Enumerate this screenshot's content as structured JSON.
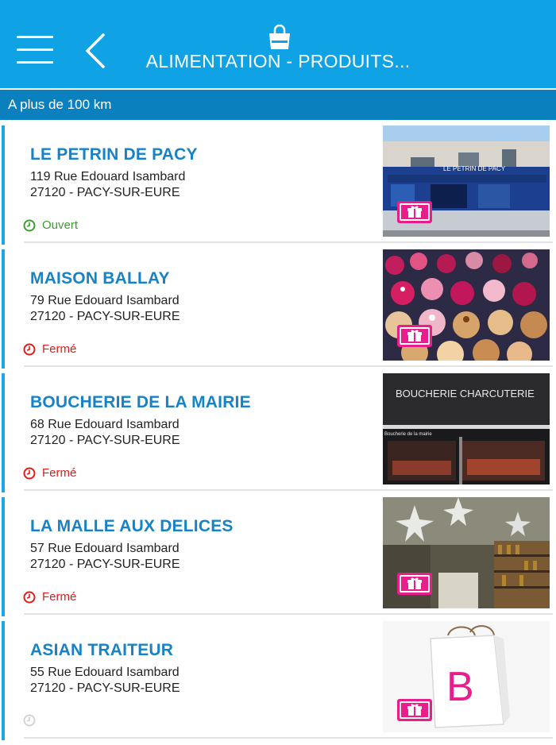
{
  "header": {
    "title": "ALIMENTATION - PRODUITS...",
    "menu_icon": "hamburger-menu-icon",
    "back_icon": "chevron-left-icon",
    "category_icon": "shopping-bag-icon",
    "bg_color": "#0fa3e6"
  },
  "subbar": {
    "label": "A plus de 100 km",
    "bg_color": "#0b80bf"
  },
  "colors": {
    "accent": "#1aa6e8",
    "name": "#1683c9",
    "open": "#3a9d2f",
    "closed": "#e11a1a",
    "gift": "#e91e8c"
  },
  "shops": [
    {
      "name": "LE PETRIN DE PACY",
      "address": "119 Rue Edouard Isambard",
      "city": "27120 - PACY-SUR-EURE",
      "status": "Ouvert",
      "status_type": "open",
      "image": "bakery-storefront"
    },
    {
      "name": "MAISON BALLAY",
      "address": "79 Rue Edouard Isambard",
      "city": "27120 - PACY-SUR-EURE",
      "status": "Fermé",
      "status_type": "closed",
      "image": "pastries"
    },
    {
      "name": "BOUCHERIE DE LA MAIRIE",
      "address": "68 Rue Edouard Isambard",
      "city": "27120 - PACY-SUR-EURE",
      "status": "Fermé",
      "status_type": "closed",
      "image": "butcher-storefront",
      "sign": "BOUCHERIE  CHARCUTERIE",
      "sign_small": "Boucherie de la mairie"
    },
    {
      "name": "LA MALLE AUX DELICES",
      "address": "57 Rue Edouard Isambard",
      "city": "27120 - PACY-SUR-EURE",
      "status": "Fermé",
      "status_type": "closed",
      "image": "deli-interior"
    },
    {
      "name": "ASIAN TRAITEUR",
      "address": "55 Rue Edouard Isambard",
      "city": "27120 - PACY-SUR-EURE",
      "status": "",
      "status_type": "unknown",
      "image": "placeholder-bag",
      "placeholder_letter": "B"
    }
  ]
}
